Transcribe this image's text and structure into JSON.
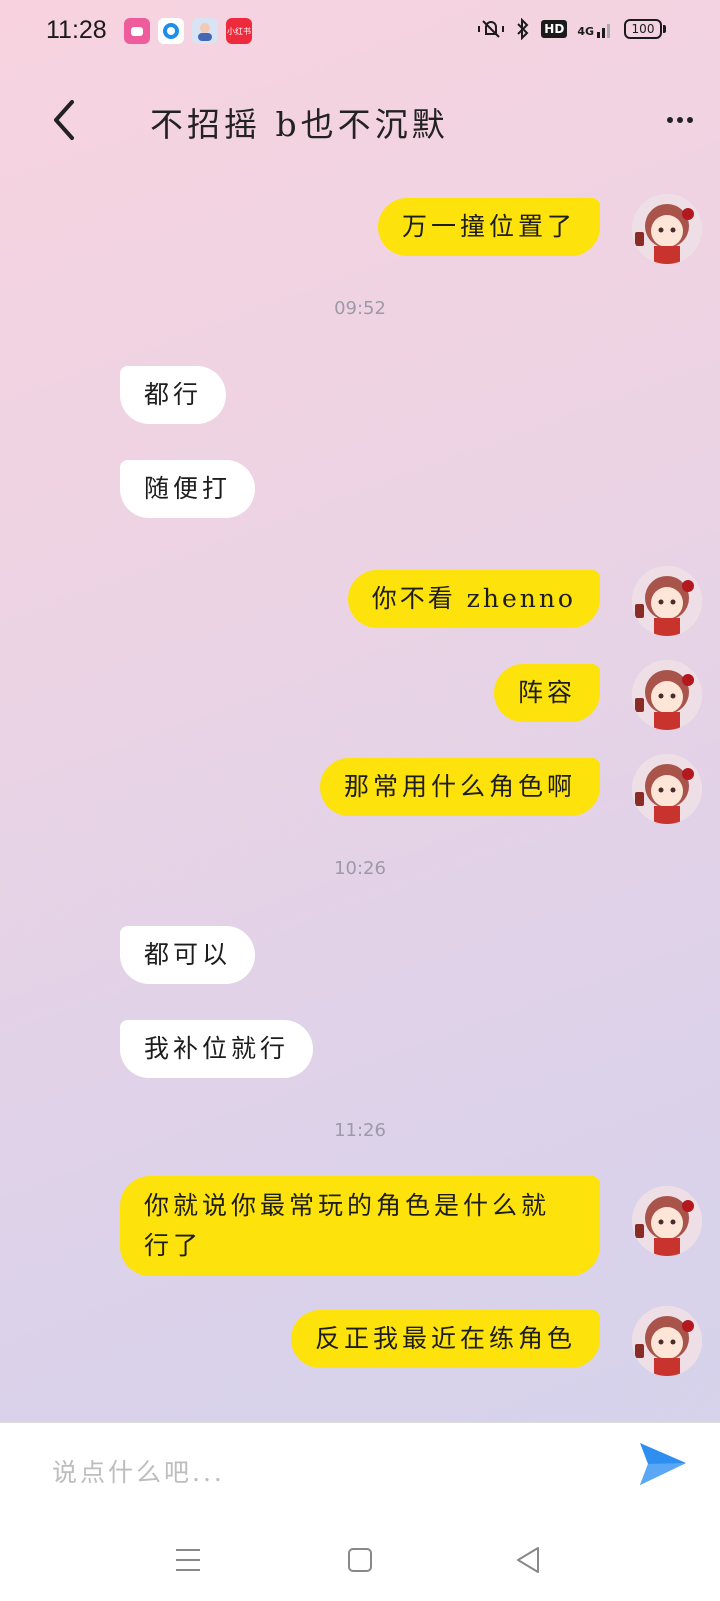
{
  "status_bar": {
    "time": "11:28",
    "app_icons": [
      "app-icon-pink",
      "app-icon-blue-circle",
      "app-icon-avatar",
      "app-icon-red"
    ],
    "app_icon_red_label": "小红书",
    "network": "4G",
    "hd": "HD",
    "battery": "100"
  },
  "header": {
    "title": "不招摇 b也不沉默",
    "back_icon": "chevron-left-icon",
    "more_icon": "more-dots-icon"
  },
  "messages": [
    {
      "from": "me",
      "text": "万一撞位置了"
    },
    {
      "type": "time",
      "text": "09:52"
    },
    {
      "from": "other",
      "text": "都行"
    },
    {
      "from": "other",
      "text": "随便打"
    },
    {
      "from": "me",
      "text": "你不看 zhenno"
    },
    {
      "from": "me",
      "text": "阵容"
    },
    {
      "from": "me",
      "text": "那常用什么角色啊"
    },
    {
      "type": "time",
      "text": "10:26"
    },
    {
      "from": "other",
      "text": "都可以"
    },
    {
      "from": "other",
      "text": "我补位就行"
    },
    {
      "type": "time",
      "text": "11:26"
    },
    {
      "from": "me",
      "text": "你就说你最常玩的角色是什么就行了"
    },
    {
      "from": "me",
      "text": "反正我最近在练角色"
    }
  ],
  "input": {
    "placeholder": "说点什么吧...",
    "send_icon": "send-arrow-icon"
  },
  "nav": [
    "menu-icon",
    "home-square-icon",
    "back-triangle-icon"
  ],
  "colors": {
    "my_bubble": "#fde20c",
    "other_bubble": "#ffffff",
    "send_button": "#2f8ff0"
  }
}
